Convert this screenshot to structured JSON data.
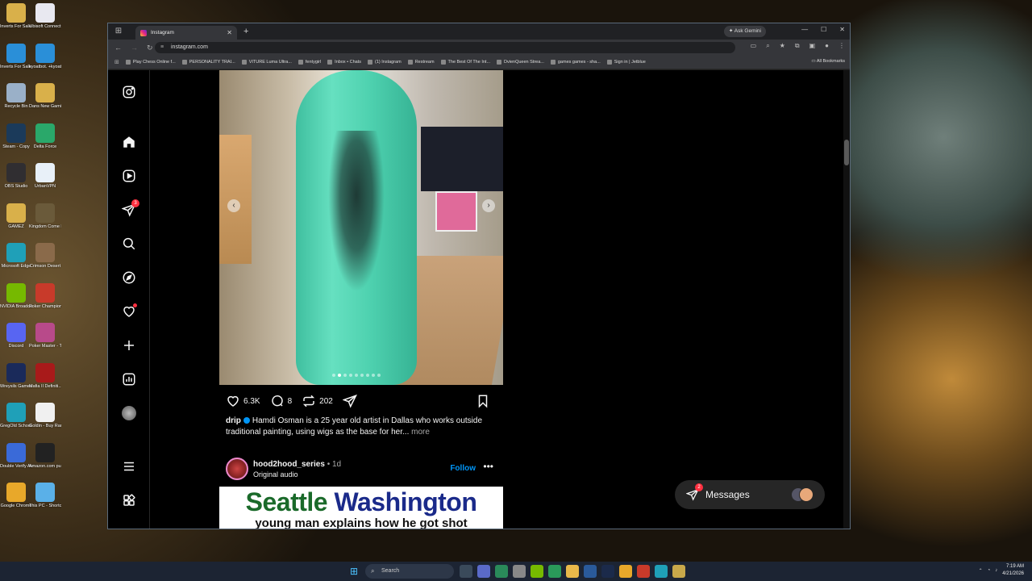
{
  "desktop": {
    "icons": [
      {
        "label": "Inverts For Sale - Spide...",
        "color": "#d9b04a"
      },
      {
        "label": "Ubisoft Connect",
        "color": "#e8e8f0"
      },
      {
        "label": "Inverts For Sale - Spide...",
        "color": "#2a8fd8"
      },
      {
        "label": "kyoatbot. +kyoatbo...",
        "color": "#2a8fd8"
      },
      {
        "label": "Recycle Bin",
        "color": "#9ab0c8"
      },
      {
        "label": "Dans New Gaming PICS",
        "color": "#d9b04a"
      },
      {
        "label": "Steam - Copy",
        "color": "#1b3a5a"
      },
      {
        "label": "Delta Force",
        "color": "#2aa86a"
      },
      {
        "label": "OBS Studio",
        "color": "#302e31"
      },
      {
        "label": "UrbanVPN",
        "color": "#e8f0f8"
      },
      {
        "label": "GAMEZ",
        "color": "#d9b04a"
      },
      {
        "label": "Kingdom Come Deliv...",
        "color": "#6a5a3a"
      },
      {
        "label": "Microsoft Edge",
        "color": "#1fa0b8"
      },
      {
        "label": "Crimson Desert",
        "color": "#8a6a4a"
      },
      {
        "label": "NVIDIA Broadcast",
        "color": "#76b900"
      },
      {
        "label": "Poker Champions...",
        "color": "#c83a2a"
      },
      {
        "label": "Discord",
        "color": "#5865f2"
      },
      {
        "label": "Poker Master - Texas Hol...",
        "color": "#b84a8a"
      },
      {
        "label": "Wreysils Games a...",
        "color": "#1a2a5a"
      },
      {
        "label": "Mafia II Definiti...",
        "color": "#a81a1a"
      },
      {
        "label": "GregOld School Run...",
        "color": "#1fa0b8"
      },
      {
        "label": "Goldin - Buy Rare Collect...",
        "color": "#f0f0f0"
      },
      {
        "label": "Double Verify Authenticat...",
        "color": "#3a6ad8"
      },
      {
        "label": "Amazon.com push ups (...",
        "color": "#222222"
      },
      {
        "label": "Google Chrome",
        "color": "#e8a82a"
      },
      {
        "label": "This PC - Shortcut",
        "color": "#5ab0e8"
      }
    ]
  },
  "browser": {
    "tab_title": "Instagram",
    "new_tab": "+",
    "ask_gemini": "Ask Gemini",
    "url": "instagram.com",
    "bookmarks": [
      "Play Chess Online f...",
      "PERSONALITY TRAI...",
      "VITURE Luma Ultra...",
      "fentygirl",
      "Inbox • Chats",
      "(1) Instagram",
      "Restream",
      "The Best Of The Int...",
      "DvienQueen Strea...",
      "games games - sha...",
      "Sign in | Jetblue"
    ],
    "all_bookmarks": "All Bookmarks"
  },
  "nav": {
    "notifications_badge": "3"
  },
  "post": {
    "likes": "6.3K",
    "comments": "8",
    "reposts": "202",
    "username": "drip",
    "caption": "Hamdi Osman is a 25 year old artist in Dallas who works outside traditional painting, using wigs as the base for her...",
    "more": "more"
  },
  "post2": {
    "username": "hood2hood_series",
    "time": "• 1d",
    "audio": "Original audio",
    "follow": "Follow",
    "more": "•••",
    "title_1": "Seattle",
    "title_2": "Washington",
    "subtitle": "young man explains how he got shot"
  },
  "messages": {
    "label": "Messages",
    "badge": "2"
  },
  "taskbar": {
    "search": "Search",
    "time": "7:19 AM",
    "date": "4/21/2026"
  }
}
